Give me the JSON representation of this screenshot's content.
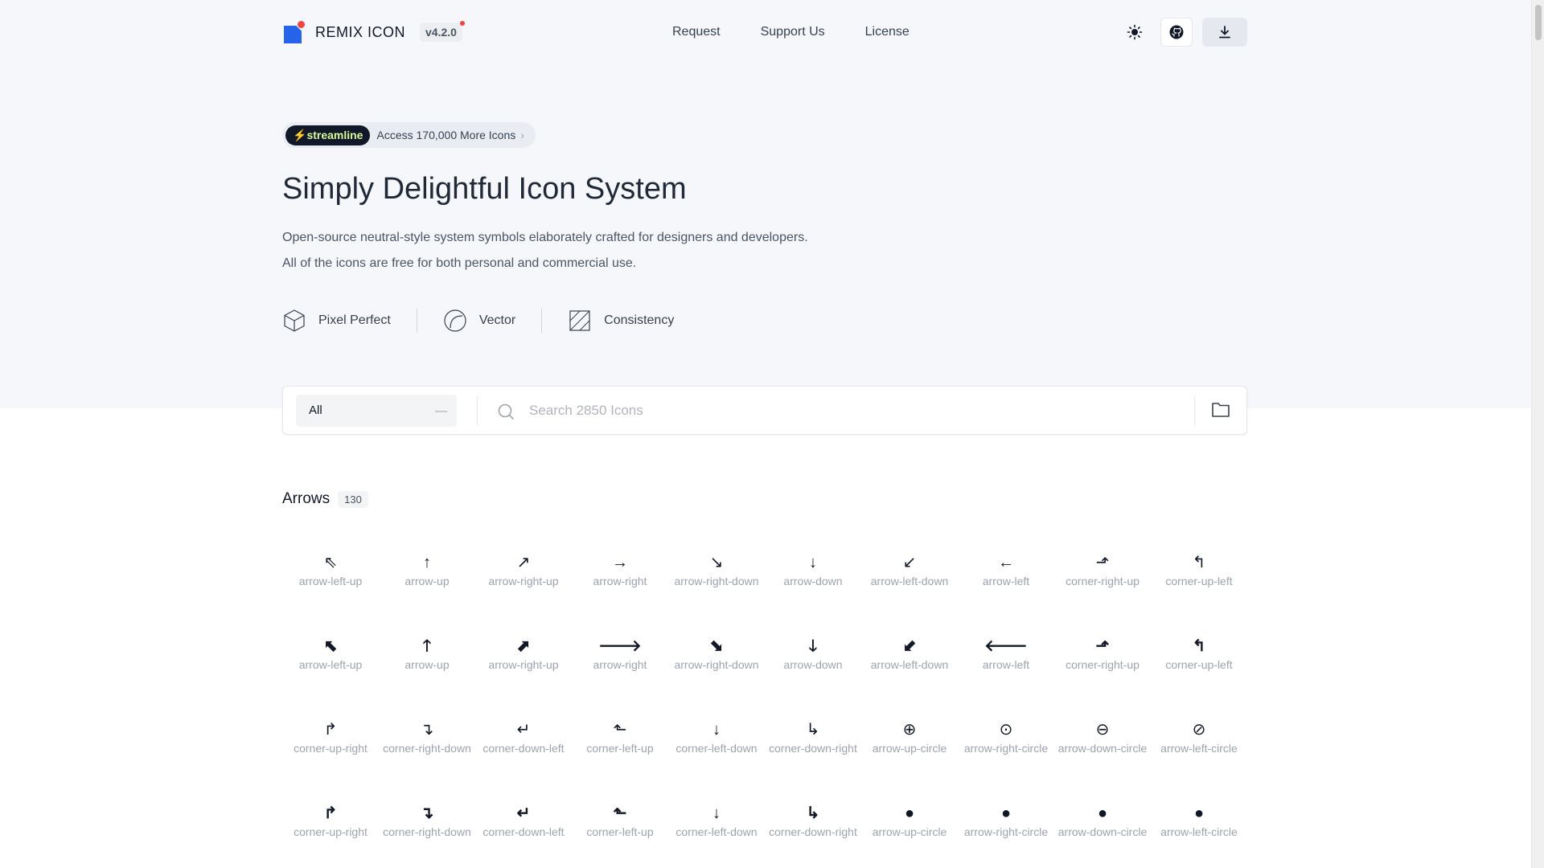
{
  "header": {
    "brand": "REMIX ICON",
    "version": "v4.2.0",
    "nav": [
      "Request",
      "Support Us",
      "License"
    ]
  },
  "promo": {
    "badge": "streamline",
    "text": "Access 170,000 More Icons"
  },
  "hero": {
    "title": "Simply Delightful Icon System",
    "desc_line1": "Open-source neutral-style system symbols elaborately crafted for designers and developers.",
    "desc_line2": "All of the icons are free for both personal and commercial use."
  },
  "features": [
    "Pixel Perfect",
    "Vector",
    "Consistency"
  ],
  "search": {
    "category": "All",
    "placeholder": "Search 2850 Icons"
  },
  "section": {
    "title": "Arrows",
    "count": "130"
  },
  "rows": [
    [
      {
        "g": "⇖",
        "label": "arrow-left-up"
      },
      {
        "g": "↑",
        "label": "arrow-up"
      },
      {
        "g": "↗",
        "label": "arrow-right-up"
      },
      {
        "g": "→",
        "label": "arrow-right"
      },
      {
        "g": "↘",
        "label": "arrow-right-down"
      },
      {
        "g": "↓",
        "label": "arrow-down"
      },
      {
        "g": "↙",
        "label": "arrow-left-down"
      },
      {
        "g": "←",
        "label": "arrow-left"
      },
      {
        "g": "⬏",
        "label": "corner-right-up"
      },
      {
        "g": "↰",
        "label": "corner-up-left"
      }
    ],
    [
      {
        "g": "⬉",
        "label": "arrow-left-up",
        "fill": true
      },
      {
        "g": "🡑",
        "label": "arrow-up",
        "fill": true
      },
      {
        "g": "⬈",
        "label": "arrow-right-up",
        "fill": true
      },
      {
        "g": "🡒",
        "label": "arrow-right",
        "fill": true
      },
      {
        "g": "⬊",
        "label": "arrow-right-down",
        "fill": true
      },
      {
        "g": "🡓",
        "label": "arrow-down",
        "fill": true
      },
      {
        "g": "⬋",
        "label": "arrow-left-down",
        "fill": true
      },
      {
        "g": "🡐",
        "label": "arrow-left",
        "fill": true
      },
      {
        "g": "⬏",
        "label": "corner-right-up",
        "fill": true
      },
      {
        "g": "↰",
        "label": "corner-up-left",
        "fill": true
      }
    ],
    [
      {
        "g": "↱",
        "label": "corner-up-right"
      },
      {
        "g": "↴",
        "label": "corner-right-down"
      },
      {
        "g": "↵",
        "label": "corner-down-left"
      },
      {
        "g": "⬑",
        "label": "corner-left-up"
      },
      {
        "g": "↓",
        "label": "corner-left-down"
      },
      {
        "g": "↳",
        "label": "corner-down-right"
      },
      {
        "g": "⊕",
        "label": "arrow-up-circle"
      },
      {
        "g": "⊙",
        "label": "arrow-right-circle"
      },
      {
        "g": "⊖",
        "label": "arrow-down-circle"
      },
      {
        "g": "⊘",
        "label": "arrow-left-circle"
      }
    ],
    [
      {
        "g": "↱",
        "label": "corner-up-right",
        "fill": true
      },
      {
        "g": "↴",
        "label": "corner-right-down",
        "fill": true
      },
      {
        "g": "↵",
        "label": "corner-down-left",
        "fill": true
      },
      {
        "g": "⬑",
        "label": "corner-left-up",
        "fill": true
      },
      {
        "g": "↓",
        "label": "corner-left-down",
        "fill": true
      },
      {
        "g": "↳",
        "label": "corner-down-right",
        "fill": true
      },
      {
        "g": "●",
        "label": "arrow-up-circle",
        "fill": true
      },
      {
        "g": "●",
        "label": "arrow-right-circle",
        "fill": true
      },
      {
        "g": "●",
        "label": "arrow-down-circle",
        "fill": true
      },
      {
        "g": "●",
        "label": "arrow-left-circle",
        "fill": true
      }
    ]
  ]
}
